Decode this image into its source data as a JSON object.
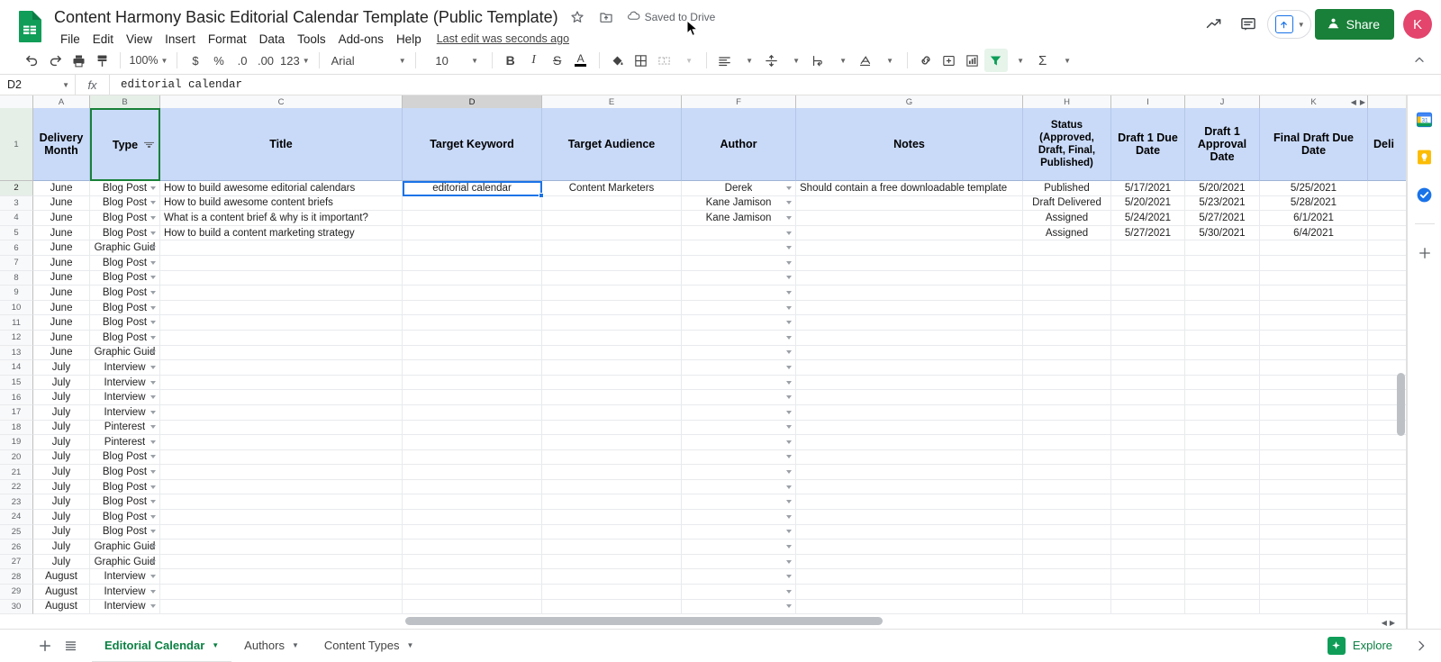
{
  "app": {
    "doc_title": "Content Harmony Basic Editorial Calendar Template (Public Template)",
    "saved_status": "Saved to Drive",
    "last_edit": "Last edit was seconds ago",
    "star_icon": "star-icon",
    "move_icon": "move-to-folder-icon",
    "cloud_icon": "cloud-saved-icon",
    "logo_icon": "sheets-logo-icon"
  },
  "menu": {
    "items": [
      "File",
      "Edit",
      "View",
      "Insert",
      "Format",
      "Data",
      "Tools",
      "Add-ons",
      "Help"
    ]
  },
  "top_right": {
    "activity_icon": "activity-trend-icon",
    "comment_icon": "comment-icon",
    "upload_icon": "present-upload-icon",
    "share_label": "Share",
    "share_icon": "share-person-icon",
    "share_color": "#188038",
    "avatar_initial": "K",
    "avatar_color": "#e3456c"
  },
  "toolbar": {
    "undo_icon": "undo-icon",
    "redo_icon": "redo-icon",
    "print_icon": "print-icon",
    "paint_icon": "paint-format-icon",
    "zoom_value": "100%",
    "currency_label": "$",
    "percent_label": "%",
    "dec_decrease_label": ".0",
    "dec_increase_label": ".00",
    "format_label": "123",
    "font_name": "Arial",
    "font_size": "10",
    "bold_label": "B",
    "italic_label": "I",
    "strike_label": "S",
    "text_color_label": "A",
    "fill_icon": "fill-color-icon",
    "borders_icon": "borders-icon",
    "merge_icon": "merge-cells-icon",
    "halign_icon": "horizontal-align-icon",
    "valign_icon": "vertical-align-icon",
    "wrap_icon": "text-wrap-icon",
    "rotate_icon": "text-rotation-icon",
    "link_icon": "insert-link-icon",
    "comment_icon": "insert-comment-icon",
    "chart_icon": "insert-chart-icon",
    "filter_icon": "filter-icon",
    "filter_active_color": "#0f9d58",
    "functions_label": "Σ",
    "collapse_icon": "collapse-toolbar-icon"
  },
  "formula_bar": {
    "name_box": "D2",
    "fx_label": "fx",
    "value": "editorial calendar"
  },
  "grid": {
    "columns": [
      "A",
      "B",
      "C",
      "D",
      "E",
      "F",
      "G",
      "H",
      "I",
      "J",
      "K"
    ],
    "selected_column": "D",
    "filtered_column": "B",
    "selected_cell": "D2",
    "nav_left_icon": "column-scroll-left-icon",
    "nav_right_icon": "column-scroll-right-icon",
    "headers": [
      "Delivery Month",
      "Type",
      "Title",
      "Target Keyword",
      "Target Audience",
      "Author",
      "Notes",
      "Status (Approved, Draft, Final, Published)",
      "Draft 1 Due Date",
      "Draft 1 Approval Date",
      "Final Draft Due Date",
      "Deli"
    ],
    "row_numbers": [
      1,
      2,
      3,
      4,
      5,
      6,
      7,
      8,
      9,
      10,
      11,
      12,
      13,
      14,
      15,
      16,
      17,
      18,
      19,
      20,
      21,
      22,
      23,
      24,
      25,
      26,
      27,
      28,
      29,
      30
    ],
    "selected_row": 2,
    "rows": [
      {
        "n": 2,
        "a": "June",
        "b": "Blog Post",
        "c": "How to build awesome editorial calendars",
        "d": "editorial calendar",
        "e": "Content Marketers",
        "f": "Derek",
        "g": "Should contain a free downloadable template",
        "h": "Published",
        "i": "5/17/2021",
        "j": "5/20/2021",
        "k": "5/25/2021"
      },
      {
        "n": 3,
        "a": "June",
        "b": "Blog Post",
        "c": "How to build awesome content briefs",
        "d": "",
        "e": "",
        "f": "Kane Jamison",
        "g": "",
        "h": "Draft Delivered",
        "i": "5/20/2021",
        "j": "5/23/2021",
        "k": "5/28/2021"
      },
      {
        "n": 4,
        "a": "June",
        "b": "Blog Post",
        "c": "What is a content brief & why is it important?",
        "d": "",
        "e": "",
        "f": "Kane Jamison",
        "g": "",
        "h": "Assigned",
        "i": "5/24/2021",
        "j": "5/27/2021",
        "k": "6/1/2021"
      },
      {
        "n": 5,
        "a": "June",
        "b": "Blog Post",
        "c": "How to build a content marketing strategy",
        "d": "",
        "e": "",
        "f": "",
        "g": "",
        "h": "Assigned",
        "i": "5/27/2021",
        "j": "5/30/2021",
        "k": "6/4/2021"
      },
      {
        "n": 6,
        "a": "June",
        "b": "Graphic Guid",
        "c": "",
        "d": "",
        "e": "",
        "f": "",
        "g": "",
        "h": "",
        "i": "",
        "j": "",
        "k": ""
      },
      {
        "n": 7,
        "a": "June",
        "b": "Blog Post",
        "c": "",
        "d": "",
        "e": "",
        "f": "",
        "g": "",
        "h": "",
        "i": "",
        "j": "",
        "k": ""
      },
      {
        "n": 8,
        "a": "June",
        "b": "Blog Post",
        "c": "",
        "d": "",
        "e": "",
        "f": "",
        "g": "",
        "h": "",
        "i": "",
        "j": "",
        "k": ""
      },
      {
        "n": 9,
        "a": "June",
        "b": "Blog Post",
        "c": "",
        "d": "",
        "e": "",
        "f": "",
        "g": "",
        "h": "",
        "i": "",
        "j": "",
        "k": ""
      },
      {
        "n": 10,
        "a": "June",
        "b": "Blog Post",
        "c": "",
        "d": "",
        "e": "",
        "f": "",
        "g": "",
        "h": "",
        "i": "",
        "j": "",
        "k": ""
      },
      {
        "n": 11,
        "a": "June",
        "b": "Blog Post",
        "c": "",
        "d": "",
        "e": "",
        "f": "",
        "g": "",
        "h": "",
        "i": "",
        "j": "",
        "k": ""
      },
      {
        "n": 12,
        "a": "June",
        "b": "Blog Post",
        "c": "",
        "d": "",
        "e": "",
        "f": "",
        "g": "",
        "h": "",
        "i": "",
        "j": "",
        "k": ""
      },
      {
        "n": 13,
        "a": "June",
        "b": "Graphic Guid",
        "c": "",
        "d": "",
        "e": "",
        "f": "",
        "g": "",
        "h": "",
        "i": "",
        "j": "",
        "k": ""
      },
      {
        "n": 14,
        "a": "July",
        "b": "Interview",
        "c": "",
        "d": "",
        "e": "",
        "f": "",
        "g": "",
        "h": "",
        "i": "",
        "j": "",
        "k": ""
      },
      {
        "n": 15,
        "a": "July",
        "b": "Interview",
        "c": "",
        "d": "",
        "e": "",
        "f": "",
        "g": "",
        "h": "",
        "i": "",
        "j": "",
        "k": ""
      },
      {
        "n": 16,
        "a": "July",
        "b": "Interview",
        "c": "",
        "d": "",
        "e": "",
        "f": "",
        "g": "",
        "h": "",
        "i": "",
        "j": "",
        "k": ""
      },
      {
        "n": 17,
        "a": "July",
        "b": "Interview",
        "c": "",
        "d": "",
        "e": "",
        "f": "",
        "g": "",
        "h": "",
        "i": "",
        "j": "",
        "k": ""
      },
      {
        "n": 18,
        "a": "July",
        "b": "Pinterest",
        "c": "",
        "d": "",
        "e": "",
        "f": "",
        "g": "",
        "h": "",
        "i": "",
        "j": "",
        "k": ""
      },
      {
        "n": 19,
        "a": "July",
        "b": "Pinterest",
        "c": "",
        "d": "",
        "e": "",
        "f": "",
        "g": "",
        "h": "",
        "i": "",
        "j": "",
        "k": ""
      },
      {
        "n": 20,
        "a": "July",
        "b": "Blog Post",
        "c": "",
        "d": "",
        "e": "",
        "f": "",
        "g": "",
        "h": "",
        "i": "",
        "j": "",
        "k": ""
      },
      {
        "n": 21,
        "a": "July",
        "b": "Blog Post",
        "c": "",
        "d": "",
        "e": "",
        "f": "",
        "g": "",
        "h": "",
        "i": "",
        "j": "",
        "k": ""
      },
      {
        "n": 22,
        "a": "July",
        "b": "Blog Post",
        "c": "",
        "d": "",
        "e": "",
        "f": "",
        "g": "",
        "h": "",
        "i": "",
        "j": "",
        "k": ""
      },
      {
        "n": 23,
        "a": "July",
        "b": "Blog Post",
        "c": "",
        "d": "",
        "e": "",
        "f": "",
        "g": "",
        "h": "",
        "i": "",
        "j": "",
        "k": ""
      },
      {
        "n": 24,
        "a": "July",
        "b": "Blog Post",
        "c": "",
        "d": "",
        "e": "",
        "f": "",
        "g": "",
        "h": "",
        "i": "",
        "j": "",
        "k": ""
      },
      {
        "n": 25,
        "a": "July",
        "b": "Blog Post",
        "c": "",
        "d": "",
        "e": "",
        "f": "",
        "g": "",
        "h": "",
        "i": "",
        "j": "",
        "k": ""
      },
      {
        "n": 26,
        "a": "July",
        "b": "Graphic Guid",
        "c": "",
        "d": "",
        "e": "",
        "f": "",
        "g": "",
        "h": "",
        "i": "",
        "j": "",
        "k": ""
      },
      {
        "n": 27,
        "a": "July",
        "b": "Graphic Guid",
        "c": "",
        "d": "",
        "e": "",
        "f": "",
        "g": "",
        "h": "",
        "i": "",
        "j": "",
        "k": ""
      },
      {
        "n": 28,
        "a": "August",
        "b": "Interview",
        "c": "",
        "d": "",
        "e": "",
        "f": "",
        "g": "",
        "h": "",
        "i": "",
        "j": "",
        "k": ""
      },
      {
        "n": 29,
        "a": "August",
        "b": "Interview",
        "c": "",
        "d": "",
        "e": "",
        "f": "",
        "g": "",
        "h": "",
        "i": "",
        "j": "",
        "k": ""
      },
      {
        "n": 30,
        "a": "August",
        "b": "Interview",
        "c": "",
        "d": "",
        "e": "",
        "f": "",
        "g": "",
        "h": "",
        "i": "",
        "j": "",
        "k": ""
      }
    ]
  },
  "side_panel": {
    "calendar_icon": "google-calendar-icon",
    "keep_icon": "google-keep-icon",
    "tasks_icon": "google-tasks-icon",
    "add_icon": "add-addon-icon"
  },
  "bottom": {
    "add_sheet_icon": "add-sheet-icon",
    "all_sheets_icon": "all-sheets-icon",
    "tabs": [
      {
        "label": "Editorial Calendar",
        "active": true
      },
      {
        "label": "Authors",
        "active": false
      },
      {
        "label": "Content Types",
        "active": false
      }
    ],
    "explore_label": "Explore",
    "explore_icon": "explore-icon",
    "expand_icon": "expand-panel-icon"
  }
}
